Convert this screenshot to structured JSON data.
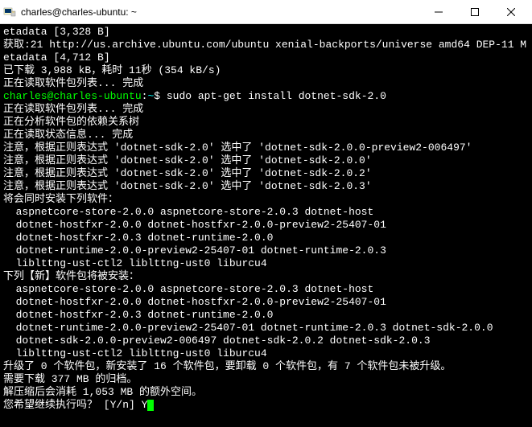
{
  "titlebar": {
    "title": "charles@charles-ubuntu: ~"
  },
  "terminal": {
    "l1": "etadata [3,328 B]",
    "l2": "获取:21 http://us.archive.ubuntu.com/ubuntu xenial-backports/universe amd64 DEP-11 Metadata [4,712 B]",
    "l3": "已下载 3,988 kB，耗时 11秒 (354 kB/s)",
    "l4": "正在读取软件包列表... 完成",
    "prompt": {
      "userhost": "charles@charles-ubuntu",
      "sep": ":",
      "path": "~",
      "dollar": "$ ",
      "cmd": "sudo apt-get install dotnet-sdk-2.0"
    },
    "l6": "正在读取软件包列表... 完成",
    "l7": "正在分析软件包的依赖关系树",
    "l8": "正在读取状态信息... 完成",
    "l9": "注意，根据正则表达式 'dotnet-sdk-2.0' 选中了 'dotnet-sdk-2.0.0-preview2-006497'",
    "l10": "注意，根据正则表达式 'dotnet-sdk-2.0' 选中了 'dotnet-sdk-2.0.0'",
    "l11": "注意，根据正则表达式 'dotnet-sdk-2.0' 选中了 'dotnet-sdk-2.0.2'",
    "l12": "注意，根据正则表达式 'dotnet-sdk-2.0' 选中了 'dotnet-sdk-2.0.3'",
    "l13": "将会同时安装下列软件：",
    "l14": "  aspnetcore-store-2.0.0 aspnetcore-store-2.0.3 dotnet-host",
    "l15": "  dotnet-hostfxr-2.0.0 dotnet-hostfxr-2.0.0-preview2-25407-01",
    "l16": "  dotnet-hostfxr-2.0.3 dotnet-runtime-2.0.0",
    "l17": "  dotnet-runtime-2.0.0-preview2-25407-01 dotnet-runtime-2.0.3",
    "l18": "  liblttng-ust-ctl2 liblttng-ust0 liburcu4",
    "l19": "下列【新】软件包将被安装：",
    "l20": "  aspnetcore-store-2.0.0 aspnetcore-store-2.0.3 dotnet-host",
    "l21": "  dotnet-hostfxr-2.0.0 dotnet-hostfxr-2.0.0-preview2-25407-01",
    "l22": "  dotnet-hostfxr-2.0.3 dotnet-runtime-2.0.0",
    "l23": "  dotnet-runtime-2.0.0-preview2-25407-01 dotnet-runtime-2.0.3 dotnet-sdk-2.0.0",
    "l24": "  dotnet-sdk-2.0.0-preview2-006497 dotnet-sdk-2.0.2 dotnet-sdk-2.0.3",
    "l25": "  liblttng-ust-ctl2 liblttng-ust0 liburcu4",
    "l26": "升级了 0 个软件包，新安装了 16 个软件包，要卸载 0 个软件包，有 7 个软件包未被升级。",
    "l27": "需要下载 377 MB 的归档。",
    "l28": "解压缩后会消耗 1,053 MB 的额外空间。",
    "l29": "您希望继续执行吗？ [Y/n] Y"
  }
}
